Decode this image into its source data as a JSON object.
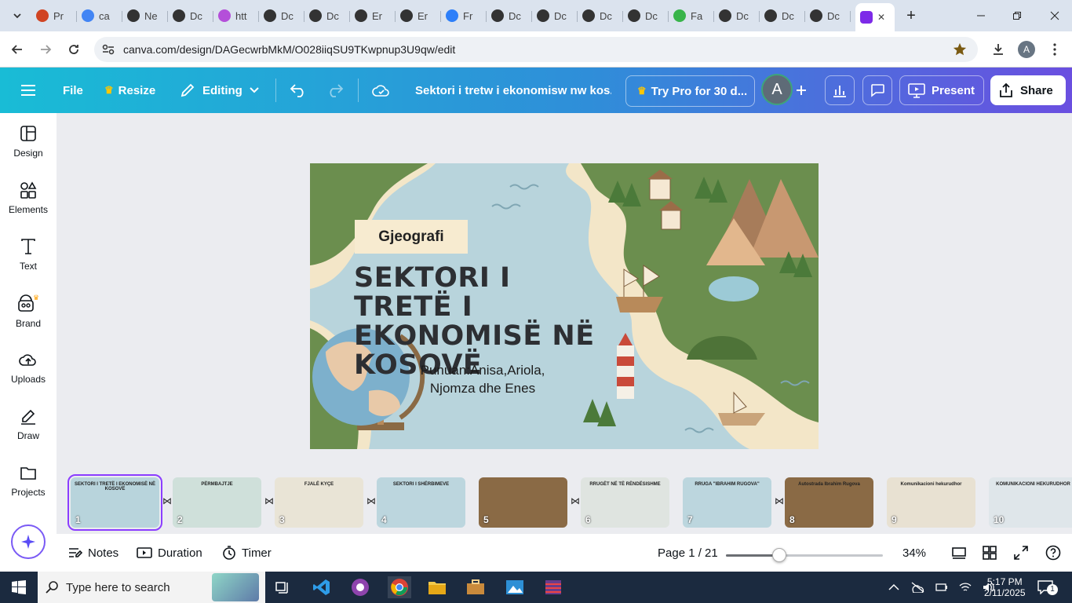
{
  "browser": {
    "tabs": [
      {
        "label": "Pr",
        "color": "#d04423"
      },
      {
        "label": "ca",
        "color": "#4285f4"
      },
      {
        "label": "Ne",
        "color": "#333333"
      },
      {
        "label": "Dc",
        "color": "#333333"
      },
      {
        "label": "htt",
        "color": "#b44fd9"
      },
      {
        "label": "Dc",
        "color": "#333333"
      },
      {
        "label": "Dc",
        "color": "#333333"
      },
      {
        "label": "Er",
        "color": "#333333"
      },
      {
        "label": "Er",
        "color": "#333333"
      },
      {
        "label": "Fr",
        "color": "#2d7ff9"
      },
      {
        "label": "Dc",
        "color": "#333333"
      },
      {
        "label": "Dc",
        "color": "#333333"
      },
      {
        "label": "Dc",
        "color": "#333333"
      },
      {
        "label": "Dc",
        "color": "#333333"
      },
      {
        "label": "Fa",
        "color": "#38b44a"
      },
      {
        "label": "Dc",
        "color": "#333333"
      },
      {
        "label": "Dc",
        "color": "#333333"
      },
      {
        "label": "Dc",
        "color": "#333333"
      }
    ],
    "active_tab_close": "✕",
    "new_tab": "+",
    "url": "canva.com/design/DAGecwrbMkM/O028iiqSU9TKwpnup3U9qw/edit",
    "profile_initial": "A"
  },
  "toolbar": {
    "file": "File",
    "resize": "Resize",
    "editing": "Editing",
    "doc_title": "Sektori i tretw i ekonomisw nw kos...",
    "try_pro": "Try Pro for 30 d...",
    "avatar": "A",
    "present": "Present",
    "share": "Share"
  },
  "sidebar": {
    "items": [
      {
        "label": "Design",
        "icon": "design-icon"
      },
      {
        "label": "Elements",
        "icon": "elements-icon"
      },
      {
        "label": "Text",
        "icon": "text-icon"
      },
      {
        "label": "Brand",
        "icon": "brand-icon"
      },
      {
        "label": "Uploads",
        "icon": "uploads-icon"
      },
      {
        "label": "Draw",
        "icon": "draw-icon"
      },
      {
        "label": "Projects",
        "icon": "projects-icon"
      }
    ]
  },
  "slide": {
    "tag": "Gjeografi",
    "title": "SEKTORI I TRETË I EKONOMISË NË KOSOVË",
    "authors_line1": "Punuan:Anisa,Ariola,",
    "authors_line2": "Njomza dhe Enes"
  },
  "filmstrip": {
    "thumbs": [
      {
        "num": "1",
        "title": "SEKTORI I TRETË I EKONOMISË NË KOSOVË",
        "bg": "#b8d4dc"
      },
      {
        "num": "2",
        "title": "PËRMBAJTJE",
        "bg": "#cfe0da"
      },
      {
        "num": "3",
        "title": "FJALË KYÇE",
        "bg": "#e9e4d6"
      },
      {
        "num": "4",
        "title": "SEKTORI I SHËRBIMEVE",
        "bg": "#bcd6de"
      },
      {
        "num": "5",
        "title": "",
        "bg": "#8a6a45"
      },
      {
        "num": "6",
        "title": "RRUGËT NË TË RËNDËSISHME",
        "bg": "#dfe4e0"
      },
      {
        "num": "7",
        "title": "RRUGA \"IBRAHIM RUGOVA\"",
        "bg": "#bcd6de"
      },
      {
        "num": "8",
        "title": "Autostrada Ibrahim Rugova",
        "bg": "#8a6a45"
      },
      {
        "num": "9",
        "title": "Komunikacioni hekurudhor",
        "bg": "#e8e1d2"
      },
      {
        "num": "10",
        "title": "KOMUNIKACIONI HEKURUDHOR",
        "bg": "#dfe6ea"
      }
    ]
  },
  "bottombar": {
    "notes": "Notes",
    "duration": "Duration",
    "timer": "Timer",
    "page": "Page 1 / 21",
    "zoom": "34%",
    "zoom_value": 0.34
  },
  "taskbar": {
    "search_placeholder": "Type here to search",
    "time": "5:17 PM",
    "date": "2/11/2025",
    "notif": "1"
  }
}
